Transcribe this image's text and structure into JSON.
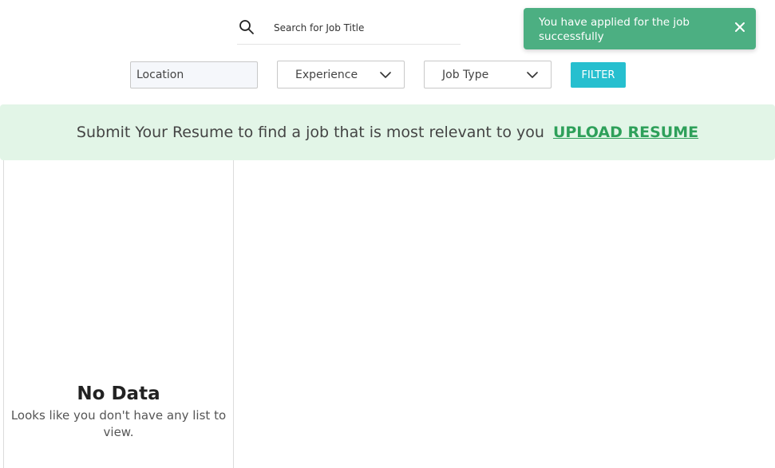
{
  "search": {
    "placeholder": "Search for Job Title",
    "icon": "search-icon"
  },
  "toast": {
    "message": "You have applied for the job successfully",
    "close_icon": "close-icon",
    "color": "#4caf82"
  },
  "filters": {
    "location_placeholder": "Location",
    "experience_label": "Experience",
    "job_type_label": "Job Type",
    "filter_button": "FILTER",
    "filter_color": "#26bfcf"
  },
  "banner": {
    "text": "Submit Your Resume to find a job that is most relevant to you",
    "link": "UPLOAD RESUME",
    "background": "#e2f5e7",
    "link_color": "#2ea05a"
  },
  "empty_state": {
    "title": "No Data",
    "subtitle": "Looks like you don't have any list to view."
  }
}
